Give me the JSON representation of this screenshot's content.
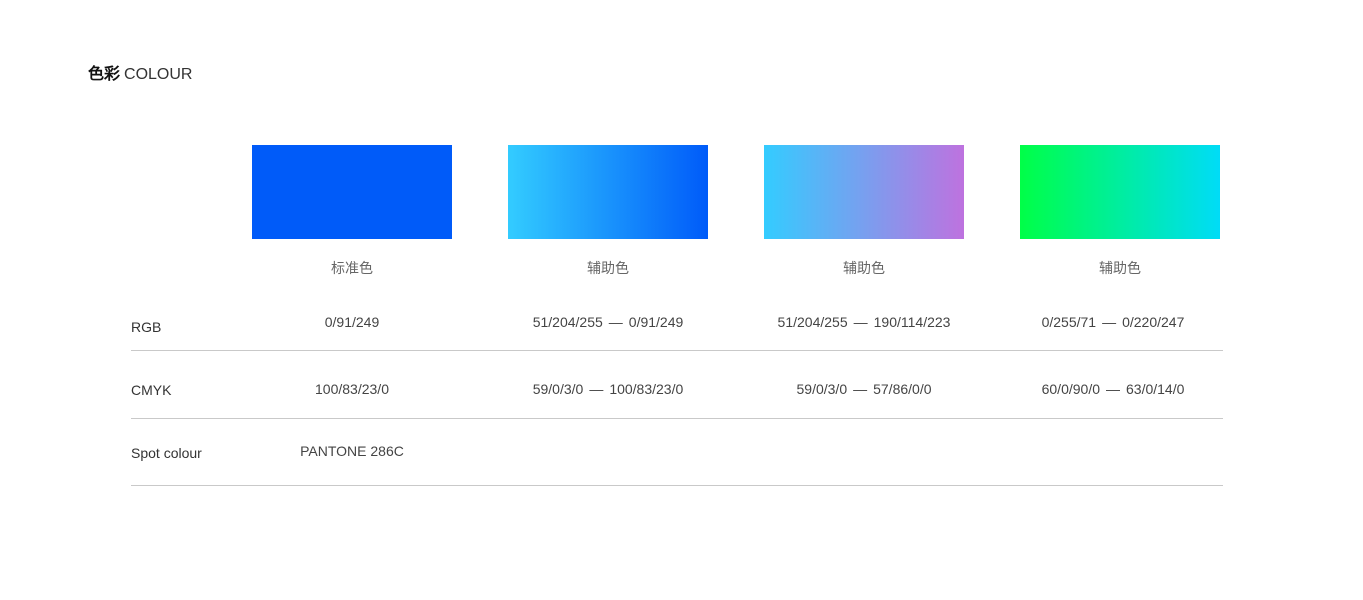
{
  "title": {
    "cn": "色彩",
    "en": "COLOUR"
  },
  "swatches": [
    {
      "label": "标准色",
      "stops": [
        "#005BF9"
      ]
    },
    {
      "label": "辅助色",
      "stops": [
        "#33CCFF",
        "#005BF9"
      ]
    },
    {
      "label": "辅助色",
      "stops": [
        "#33CCFF",
        "#BE72DF"
      ]
    },
    {
      "label": "辅助色",
      "stops": [
        "#00FF47",
        "#00DCF7"
      ]
    }
  ],
  "rows": {
    "rgb": {
      "label": "RGB",
      "values": [
        {
          "from": "0/91/249",
          "sep": "",
          "to": ""
        },
        {
          "from": "51/204/255",
          "sep": "—",
          "to": "0/91/249"
        },
        {
          "from": "51/204/255",
          "sep": "—",
          "to": "190/114/223"
        },
        {
          "from": "0/255/71",
          "sep": "—",
          "to": "0/220/247"
        }
      ]
    },
    "cmyk": {
      "label": "CMYK",
      "values": [
        {
          "from": "100/83/23/0",
          "sep": "",
          "to": ""
        },
        {
          "from": "59/0/3/0",
          "sep": "—",
          "to": "100/83/23/0"
        },
        {
          "from": "59/0/3/0",
          "sep": "—",
          "to": "57/86/0/0"
        },
        {
          "from": "60/0/90/0",
          "sep": "—",
          "to": "63/0/14/0"
        }
      ]
    },
    "spot": {
      "label": "Spot colour",
      "value": "PANTONE 286C"
    }
  }
}
